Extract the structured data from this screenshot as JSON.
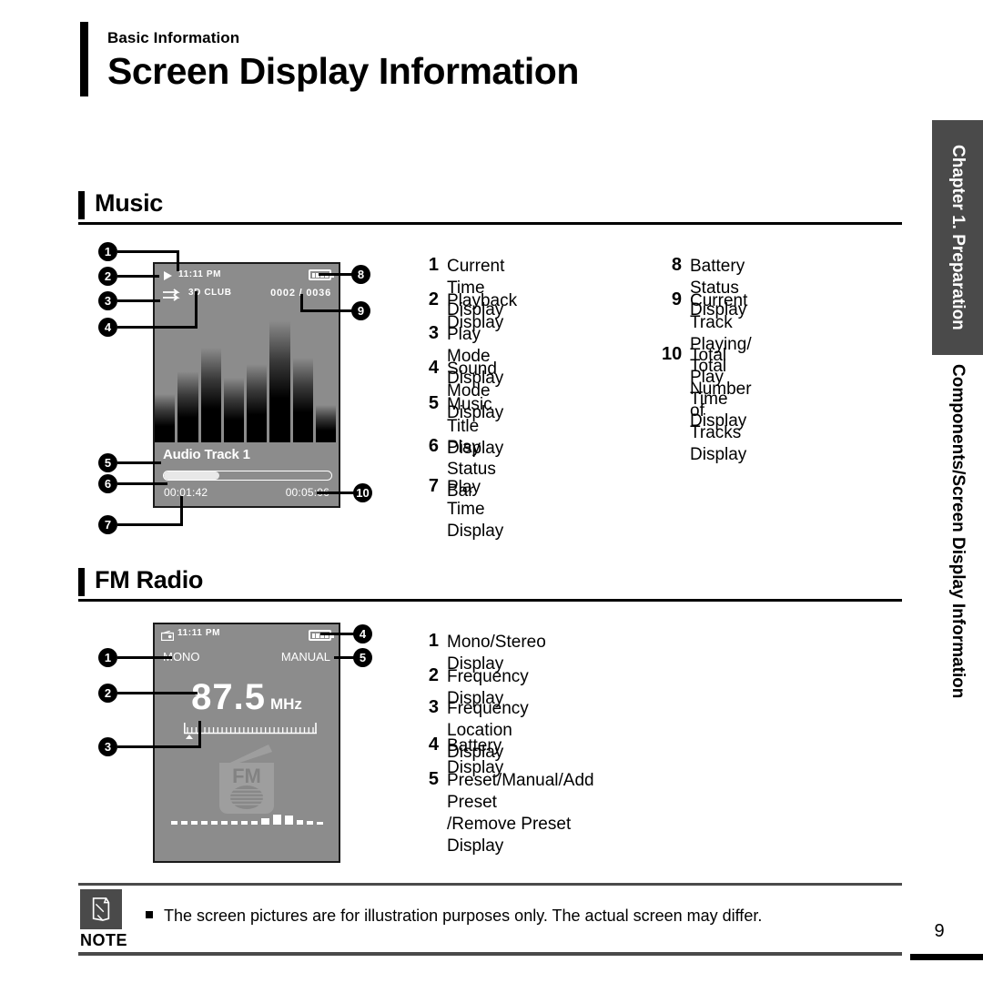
{
  "header": {
    "eyebrow": "Basic Information",
    "title": "Screen Display Information"
  },
  "sections": {
    "music": {
      "title": "Music"
    },
    "fm": {
      "title": "FM Radio"
    }
  },
  "music_screen": {
    "current_time": "11:11 PM",
    "playback_icon": "play-icon",
    "play_mode_icon": "repeat-arrows-icon",
    "sound_mode": "3D CLUB",
    "track_count": "0002 / 0036",
    "battery_icon": "battery-full-icon",
    "battery_bars": 4,
    "title": "Audio Track 1",
    "elapsed": "00:01:42",
    "total": "00:05:06",
    "progress_percent": 33,
    "visualizer_bars": [
      38,
      55,
      72,
      50,
      60,
      92,
      65,
      30
    ]
  },
  "music_callouts": [
    "1",
    "2",
    "3",
    "4",
    "5",
    "6",
    "7",
    "8",
    "9",
    "10"
  ],
  "music_legend_left": [
    {
      "num": "1",
      "label": "Current Time Display"
    },
    {
      "num": "2",
      "label": "Playback Display"
    },
    {
      "num": "3",
      "label": "Play Mode Display"
    },
    {
      "num": "4",
      "label": "Sound Mode Display"
    },
    {
      "num": "5",
      "label": "Music Title Display"
    },
    {
      "num": "6",
      "label": "Play Status Bar"
    },
    {
      "num": "7",
      "label": "Play Time Display"
    }
  ],
  "music_legend_right": [
    {
      "num": "8",
      "label": "Battery Status Display"
    },
    {
      "num": "9",
      "label": "Current Track Playing/\nTotal Number of Tracks Display"
    },
    {
      "num": "10",
      "label": "Total Play Time Display"
    }
  ],
  "fm_screen": {
    "radio_icon": "radio-icon",
    "current_time": "11:11 PM",
    "mono_label": "MONO",
    "manual_label": "MANUAL",
    "frequency": "87.5",
    "frequency_unit": "MHz",
    "battery_icon": "battery-full-icon",
    "battery_bars": 4,
    "logo_text": "FM",
    "scale_ticks": 30,
    "marker_position_percent": 3,
    "eq_bars": [
      4,
      4,
      4,
      4,
      4,
      4,
      4,
      4,
      4,
      7,
      11,
      10,
      5,
      4,
      3
    ]
  },
  "fm_callouts": [
    "1",
    "2",
    "3",
    "4",
    "5"
  ],
  "fm_legend": [
    {
      "num": "1",
      "label": "Mono/Stereo Display"
    },
    {
      "num": "2",
      "label": "Frequency Display"
    },
    {
      "num": "3",
      "label": "Frequency Location Display"
    },
    {
      "num": "4",
      "label": "Battery Display"
    },
    {
      "num": "5",
      "label": "Preset/Manual/Add Preset\n/Remove Preset Display"
    }
  ],
  "sidebar": {
    "chapter": "Chapter 1. Preparation",
    "section": "Components/Screen Display Information"
  },
  "note": {
    "label": "NOTE",
    "icon": "pencil-icon",
    "text": "The screen pictures are for illustration purposes only. The actual screen may differ."
  },
  "footer": {
    "page_number": "9"
  },
  "colors": {
    "screen_bg": "#8c8c8c",
    "screen_border": "#1a1a1a",
    "sidebar_dark": "#4a4a4a",
    "ink": "#000000",
    "screen_text": "#ffffff"
  }
}
